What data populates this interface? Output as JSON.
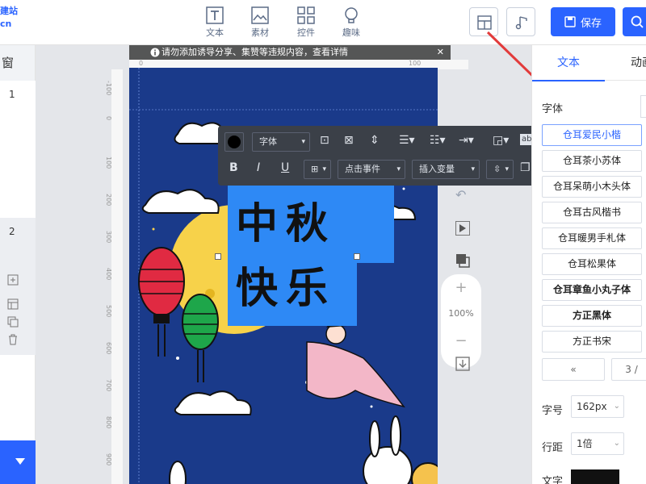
{
  "brand": {
    "line1": "建站",
    "line2": "cn"
  },
  "toolbar": {
    "items": [
      {
        "label": "文本",
        "icon": "text-icon"
      },
      {
        "label": "素材",
        "icon": "image-icon"
      },
      {
        "label": "控件",
        "icon": "grid-icon"
      },
      {
        "label": "趣味",
        "icon": "bulb-icon"
      }
    ],
    "save_label": "保存"
  },
  "left_panel": {
    "title": "窗",
    "pages": [
      "1",
      "2"
    ]
  },
  "workspace": {
    "notice": "请勿添加诱导分享、集赞等违规内容，查看详情",
    "ruler_top": [
      "0",
      "100"
    ],
    "ruler_left": [
      "-100",
      "0",
      "100",
      "200",
      "300",
      "400",
      "500",
      "600",
      "700",
      "800",
      "900"
    ],
    "zoom": "100%"
  },
  "text_toolbar": {
    "font_label": "字体",
    "event_label": "点击事件",
    "variable_label": "插入变量"
  },
  "canvas_text": [
    "中秋",
    "快乐"
  ],
  "right_panel": {
    "tabs": [
      "文本",
      "动画"
    ],
    "font_label": "字体",
    "fonts": [
      "仓耳爱民小楷",
      "仓耳茶小苏体",
      "仓耳呆萌小木头体",
      "仓耳古风楷书",
      "仓耳暖男手札体",
      "仓耳松果体",
      "仓耳章鱼小丸子体",
      "方正黑体",
      "方正书宋"
    ],
    "pager_prev": "«",
    "pager_page": "3 /",
    "size_label": "字号",
    "size_value": "162px",
    "spacing_label": "行距",
    "spacing_value": "1倍",
    "color_label": "文字"
  },
  "colors": {
    "accent": "#2a63ff",
    "canvas_bg": "#1a3a8a",
    "selection": "#2e89f5",
    "text_color": "#111111"
  }
}
